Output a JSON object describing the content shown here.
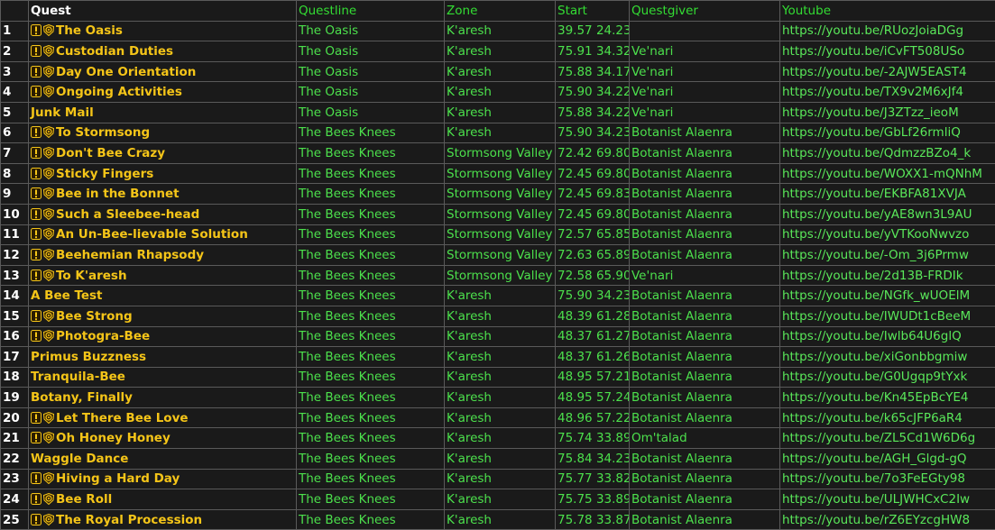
{
  "headers": {
    "num": "",
    "quest": "Quest",
    "questline": "Questline",
    "zone": "Zone",
    "start": "Start",
    "questgiver": "Questgiver",
    "youtube": "Youtube"
  },
  "colors": {
    "background": "#1a1a1a",
    "quest_text": "#f5c518",
    "green_text": "#4ce04c",
    "header_green": "#33dd33",
    "grid": "#5a5a5a"
  },
  "rows": [
    {
      "num": "1",
      "quest": "The Oasis",
      "icons": [
        "exclamation-quest-icon",
        "lion-crest-icon"
      ],
      "questline": "The Oasis",
      "zone": "K'aresh",
      "start": "39.57 24.23",
      "questgiver": "",
      "youtube": "https://youtu.be/RUozJoiaDGg"
    },
    {
      "num": "2",
      "quest": "Custodian Duties",
      "icons": [
        "exclamation-quest-icon",
        "lion-crest-icon"
      ],
      "questline": "The Oasis",
      "zone": "K'aresh",
      "start": "75.91 34.32",
      "questgiver": "Ve'nari",
      "youtube": "https://youtu.be/iCvFT508USo"
    },
    {
      "num": "3",
      "quest": "Day One Orientation",
      "icons": [
        "exclamation-quest-icon",
        "lion-crest-icon"
      ],
      "questline": "The Oasis",
      "zone": "K'aresh",
      "start": "75.88 34.17",
      "questgiver": "Ve'nari",
      "youtube": "https://youtu.be/-2AJW5EAST4"
    },
    {
      "num": "4",
      "quest": "Ongoing Activities",
      "icons": [
        "exclamation-quest-icon",
        "lion-crest-icon"
      ],
      "questline": "The Oasis",
      "zone": "K'aresh",
      "start": "75.90 34.22",
      "questgiver": "Ve'nari",
      "youtube": "https://youtu.be/TX9v2M6xJf4"
    },
    {
      "num": "5",
      "quest": "Junk Mail",
      "icons": [],
      "questline": "The Oasis",
      "zone": "K'aresh",
      "start": "75.88 34.22",
      "questgiver": "Ve'nari",
      "youtube": "https://youtu.be/J3ZTzz_ieoM"
    },
    {
      "num": "6",
      "quest": "To Stormsong",
      "icons": [
        "exclamation-quest-icon",
        "lion-crest-icon"
      ],
      "questline": "The Bees Knees",
      "zone": "K'aresh",
      "start": "75.90 34.23",
      "questgiver": "Botanist Alaenra",
      "youtube": "https://youtu.be/GbLf26rmliQ"
    },
    {
      "num": "7",
      "quest": "Don't Bee Crazy",
      "icons": [
        "exclamation-quest-icon",
        "lion-crest-icon"
      ],
      "questline": "The Bees Knees",
      "zone": "Stormsong Valley",
      "start": "72.42 69.80",
      "questgiver": "Botanist Alaenra",
      "youtube": "https://youtu.be/QdmzzBZo4_k"
    },
    {
      "num": "8",
      "quest": "Sticky Fingers",
      "icons": [
        "exclamation-quest-icon",
        "lion-crest-icon"
      ],
      "questline": "The Bees Knees",
      "zone": "Stormsong Valley",
      "start": "72.45 69.80",
      "questgiver": "Botanist Alaenra",
      "youtube": "https://youtu.be/WOXX1-mQNhM"
    },
    {
      "num": "9",
      "quest": "Bee in the Bonnet",
      "icons": [
        "exclamation-quest-icon",
        "lion-crest-icon"
      ],
      "questline": "The Bees Knees",
      "zone": "Stormsong Valley",
      "start": "72.45 69.83",
      "questgiver": "Botanist Alaenra",
      "youtube": "https://youtu.be/EKBFA81XVJA"
    },
    {
      "num": "10",
      "quest": "Such a Sleebee-head",
      "icons": [
        "exclamation-quest-icon",
        "lion-crest-icon"
      ],
      "questline": "The Bees Knees",
      "zone": "Stormsong Valley",
      "start": "72.45 69.80",
      "questgiver": "Botanist Alaenra",
      "youtube": "https://youtu.be/yAE8wn3L9AU"
    },
    {
      "num": "11",
      "quest": "An Un-Bee-lievable Solution",
      "icons": [
        "exclamation-quest-icon",
        "lion-crest-icon"
      ],
      "questline": "The Bees Knees",
      "zone": "Stormsong Valley",
      "start": "72.57 65.85",
      "questgiver": "Botanist Alaenra",
      "youtube": "https://youtu.be/yVTKooNwvzo"
    },
    {
      "num": "12",
      "quest": "Beehemian Rhapsody",
      "icons": [
        "exclamation-quest-icon",
        "lion-crest-icon"
      ],
      "questline": "The Bees Knees",
      "zone": "Stormsong Valley",
      "start": "72.63 65.89",
      "questgiver": "Botanist Alaenra",
      "youtube": "https://youtu.be/-Om_3j6Prmw"
    },
    {
      "num": "13",
      "quest": "To K'aresh",
      "icons": [
        "exclamation-quest-icon",
        "lion-crest-icon"
      ],
      "questline": "The Bees Knees",
      "zone": "Stormsong Valley",
      "start": "72.58 65.90",
      "questgiver": "Ve'nari",
      "youtube": "https://youtu.be/2d13B-FRDIk"
    },
    {
      "num": "14",
      "quest": "A Bee Test",
      "icons": [],
      "questline": "The Bees Knees",
      "zone": "K'aresh",
      "start": "75.90 34.23",
      "questgiver": "Botanist Alaenra",
      "youtube": "https://youtu.be/NGfk_wUOElM"
    },
    {
      "num": "15",
      "quest": "Bee Strong",
      "icons": [
        "exclamation-quest-icon",
        "lion-crest-icon"
      ],
      "questline": "The Bees Knees",
      "zone": "K'aresh",
      "start": "48.39 61.28",
      "questgiver": "Botanist Alaenra",
      "youtube": "https://youtu.be/IWUDt1cBeeM"
    },
    {
      "num": "16",
      "quest": "Photogra-Bee",
      "icons": [
        "exclamation-quest-icon",
        "lion-crest-icon"
      ],
      "questline": "The Bees Knees",
      "zone": "K'aresh",
      "start": "48.37 61.27",
      "questgiver": "Botanist Alaenra",
      "youtube": "https://youtu.be/Iwlb64U6glQ"
    },
    {
      "num": "17",
      "quest": "Primus Buzzness",
      "icons": [],
      "questline": "The Bees Knees",
      "zone": "K'aresh",
      "start": "48.37 61.26",
      "questgiver": "Botanist Alaenra",
      "youtube": "https://youtu.be/xiGonbbgmiw"
    },
    {
      "num": "18",
      "quest": "Tranquila-Bee",
      "icons": [],
      "questline": "The Bees Knees",
      "zone": "K'aresh",
      "start": "48.95 57.21",
      "questgiver": "Botanist Alaenra",
      "youtube": "https://youtu.be/G0Ugqp9tYxk"
    },
    {
      "num": "19",
      "quest": "Botany, Finally",
      "icons": [],
      "questline": "The Bees Knees",
      "zone": "K'aresh",
      "start": "48.95 57.24",
      "questgiver": "Botanist Alaenra",
      "youtube": "https://youtu.be/Kn45EpBcYE4"
    },
    {
      "num": "20",
      "quest": "Let There Bee Love",
      "icons": [
        "exclamation-quest-icon",
        "lion-crest-icon"
      ],
      "questline": "The Bees Knees",
      "zone": "K'aresh",
      "start": "48.96 57.22",
      "questgiver": "Botanist Alaenra",
      "youtube": "https://youtu.be/k65cJFP6aR4"
    },
    {
      "num": "21",
      "quest": "Oh Honey Honey",
      "icons": [
        "exclamation-quest-icon",
        "lion-crest-icon"
      ],
      "questline": "The Bees Knees",
      "zone": "K'aresh",
      "start": "75.74 33.89",
      "questgiver": "Om'talad",
      "youtube": "https://youtu.be/ZL5Cd1W6D6g"
    },
    {
      "num": "22",
      "quest": "Waggle Dance",
      "icons": [],
      "questline": "The Bees Knees",
      "zone": "K'aresh",
      "start": "75.84 34.23",
      "questgiver": "Botanist Alaenra",
      "youtube": "https://youtu.be/AGH_Glgd-gQ"
    },
    {
      "num": "23",
      "quest": "Hiving a Hard Day",
      "icons": [
        "exclamation-quest-icon",
        "lion-crest-icon"
      ],
      "questline": "The Bees Knees",
      "zone": "K'aresh",
      "start": "75.77 33.82",
      "questgiver": "Botanist Alaenra",
      "youtube": "https://youtu.be/7o3FeEGty98"
    },
    {
      "num": "24",
      "quest": "Bee Roll",
      "icons": [
        "exclamation-quest-icon",
        "lion-crest-icon"
      ],
      "questline": "The Bees Knees",
      "zone": "K'aresh",
      "start": "75.75 33.89",
      "questgiver": "Botanist Alaenra",
      "youtube": "https://youtu.be/ULJWHCxC2Iw"
    },
    {
      "num": "25",
      "quest": "The Royal Procession",
      "icons": [
        "exclamation-quest-icon",
        "lion-crest-icon"
      ],
      "questline": "The Bees Knees",
      "zone": "K'aresh",
      "start": "75.78 33.87",
      "questgiver": "Botanist Alaenra",
      "youtube": "https://youtu.be/rZ6EYzcgHW8"
    }
  ]
}
